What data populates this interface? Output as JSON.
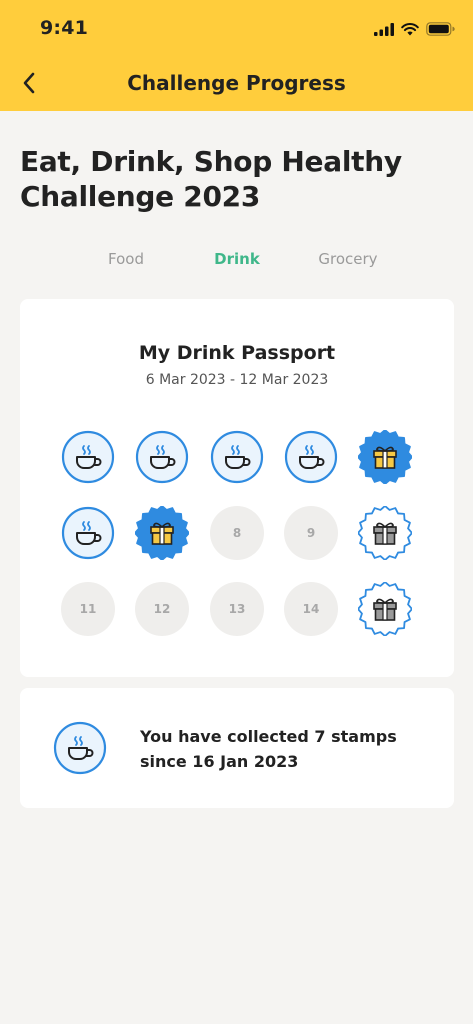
{
  "status": {
    "time": "9:41"
  },
  "nav": {
    "title": "Challenge Progress"
  },
  "page": {
    "title": "Eat, Drink, Shop Healthy Challenge 2023"
  },
  "tabs": [
    {
      "label": "Food",
      "active": false
    },
    {
      "label": "Drink",
      "active": true
    },
    {
      "label": "Grocery",
      "active": false
    }
  ],
  "passport": {
    "title": "My Drink Passport",
    "date_range": "6 Mar 2023 - 12 Mar 2023",
    "stamps": [
      {
        "type": "cup"
      },
      {
        "type": "cup"
      },
      {
        "type": "cup"
      },
      {
        "type": "cup"
      },
      {
        "type": "gift-earned"
      },
      {
        "type": "cup"
      },
      {
        "type": "gift-earned"
      },
      {
        "type": "empty",
        "label": "8"
      },
      {
        "type": "empty",
        "label": "9"
      },
      {
        "type": "gift-locked"
      },
      {
        "type": "empty",
        "label": "11"
      },
      {
        "type": "empty",
        "label": "12"
      },
      {
        "type": "empty",
        "label": "13"
      },
      {
        "type": "empty",
        "label": "14"
      },
      {
        "type": "gift-locked"
      }
    ]
  },
  "summary": {
    "text": "You have collected 7 stamps since 16 Jan 2023"
  },
  "colors": {
    "header": "#ffcd3c",
    "accent_blue": "#2f8be0",
    "active_tab": "#3fb78a",
    "gift_gold": "#f6c945",
    "locked_gray": "#9a9a9a"
  }
}
